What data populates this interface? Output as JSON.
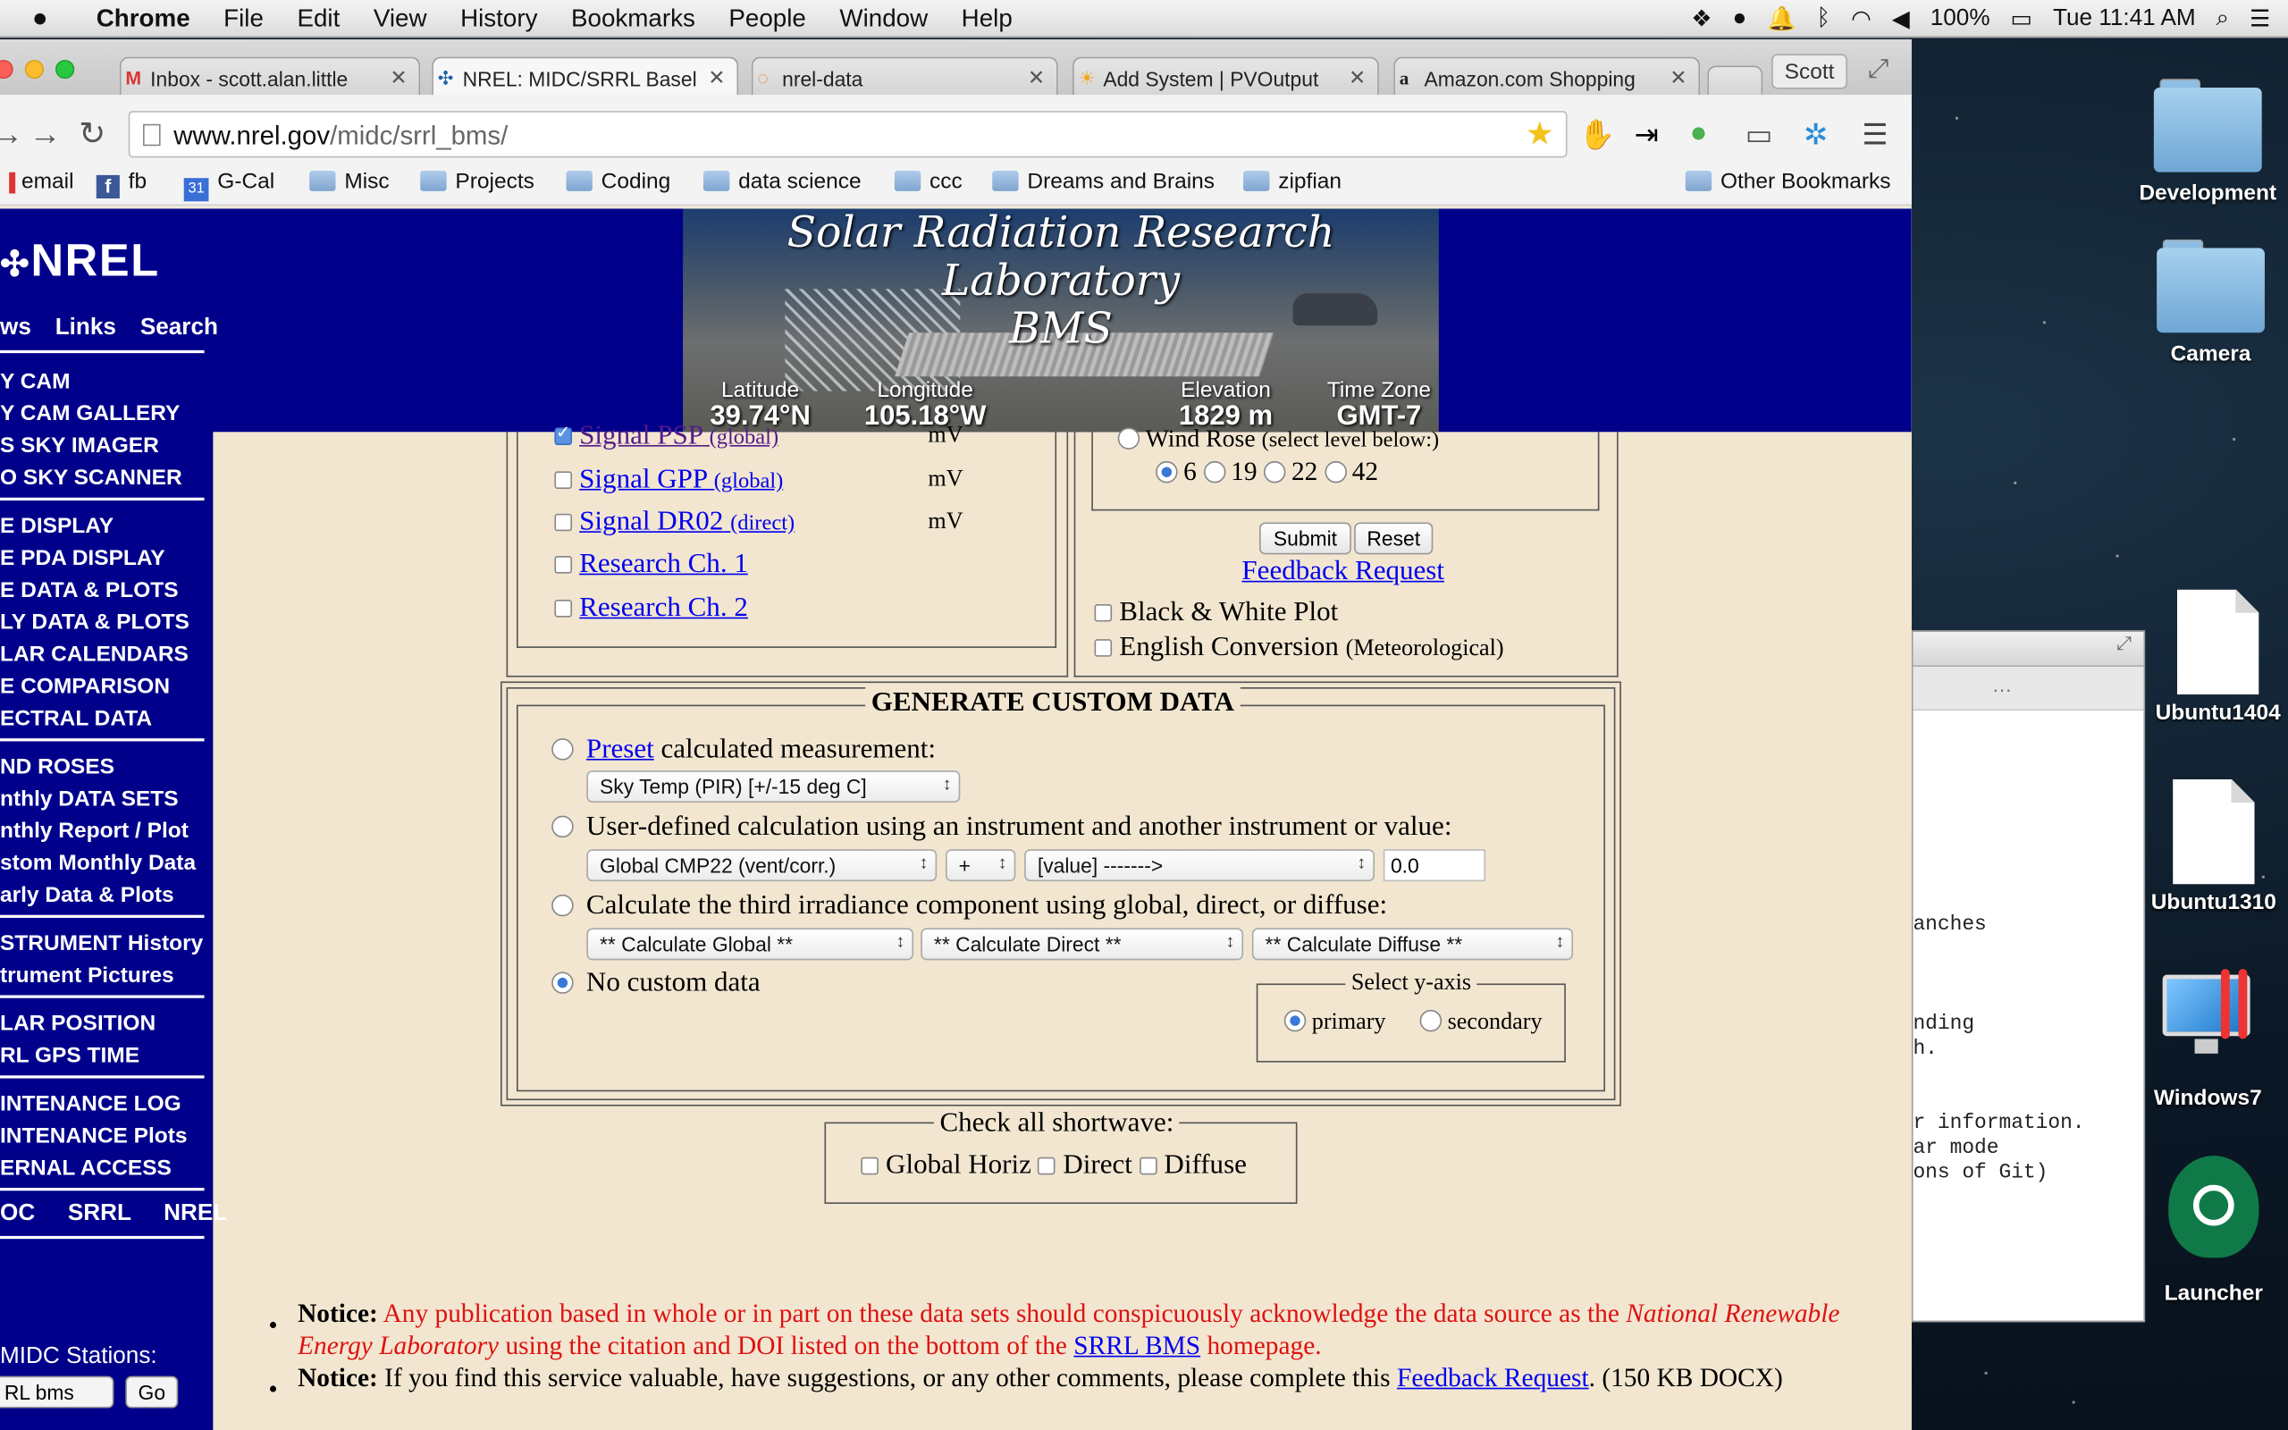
{
  "menubar": {
    "app": "Chrome",
    "items": [
      "File",
      "Edit",
      "View",
      "History",
      "Bookmarks",
      "People",
      "Window",
      "Help"
    ],
    "battery": "100%",
    "clock": "Tue 11:41 AM"
  },
  "desktop": {
    "icons": [
      "Development",
      "Camera",
      "Ubuntu1404",
      "Ubuntu1310",
      "Windows7",
      "Launcher"
    ],
    "terminal_lines": [
      "",
      "",
      "",
      "",
      "",
      "anches",
      "",
      "",
      "",
      "nding",
      "h.",
      "",
      "",
      "r information.",
      "ar mode",
      "ons of Git)"
    ]
  },
  "browser": {
    "tabs": [
      {
        "label": "Inbox - scott.alan.little",
        "icon": "gmail-icon"
      },
      {
        "label": "NREL: MIDC/SRRL Basel",
        "icon": "nrel-icon"
      },
      {
        "label": "nrel-data",
        "icon": "loading-icon"
      },
      {
        "label": "Add System | PVOutput",
        "icon": "sun-icon"
      },
      {
        "label": "Amazon.com Shopping",
        "icon": "amazon-icon"
      }
    ],
    "profile": "Scott",
    "url_host": "www.nrel.gov",
    "url_path": "/midc/srrl_bms/",
    "bookmarks": [
      "email",
      "fb",
      "G-Cal",
      "Misc",
      "Projects",
      "Coding",
      "data science",
      "ccc",
      "Dreams and Brains",
      "zipfian"
    ],
    "other_bookmarks": "Other Bookmarks",
    "gcal_badge": "31"
  },
  "page": {
    "logo": "NREL",
    "banner": {
      "title_line1": "Solar Radiation Research Laboratory",
      "title_line2": "BMS",
      "latitude_label": "Latitude",
      "latitude": "39.74°N",
      "longitude_label": "Longitude",
      "longitude": "105.18°W",
      "elevation_label": "Elevation",
      "elevation": "1829 m",
      "timezone_label": "Time Zone",
      "timezone": "GMT-7"
    },
    "sidebar": {
      "top_links": [
        "ws",
        "Links",
        "Search"
      ],
      "items": [
        "Y CAM",
        "Y CAM GALLERY",
        "S SKY IMAGER",
        "O SKY SCANNER",
        "E DISPLAY",
        "E PDA DISPLAY",
        "E DATA & PLOTS",
        "LY DATA & PLOTS",
        "LAR CALENDARS",
        "E COMPARISON",
        "ECTRAL DATA",
        "ND ROSES",
        "nthly DATA SETS",
        "nthly Report / Plot",
        "stom Monthly Data",
        "arly Data & Plots",
        "STRUMENT History",
        "trument Pictures",
        "LAR POSITION",
        "RL GPS TIME",
        "INTENANCE LOG",
        "INTENANCE Plots",
        "ERNAL ACCESS"
      ],
      "bottom_links": [
        "OC",
        "SRRL",
        "NREL"
      ],
      "stations_label": "MIDC Stations:",
      "station_value": "RL bms",
      "go": "Go"
    },
    "signals": [
      {
        "label": "Signal PSP",
        "qualifier": "(global)",
        "unit": "mV",
        "checked": true
      },
      {
        "label": "Signal GPP",
        "qualifier": "(global)",
        "unit": "mV",
        "checked": false
      },
      {
        "label": "Signal DR02",
        "qualifier": "(direct)",
        "unit": "mV",
        "checked": false
      },
      {
        "label": "Research Ch. 1",
        "qualifier": "",
        "unit": "",
        "checked": false
      },
      {
        "label": "Research Ch. 2",
        "qualifier": "",
        "unit": "",
        "checked": false
      }
    ],
    "wind_rose": {
      "label": "Wind Rose",
      "note": "(select level below:)",
      "levels": [
        "6",
        "19",
        "22",
        "42"
      ],
      "selected": "6"
    },
    "submit": "Submit",
    "reset": "Reset",
    "feedback": "Feedback Request",
    "bw_plot": "Black & White Plot",
    "english_conversion": "English Conversion",
    "english_note": "(Meteorological)",
    "custom": {
      "legend": "GENERATE CUSTOM DATA",
      "preset_link": "Preset",
      "preset_text": "calculated measurement:",
      "preset_select": "Sky Temp (PIR) [+/-15 deg C]",
      "userdef_text": "User-defined calculation using an instrument and another instrument or value:",
      "inst_select": "Global CMP22 (vent/corr.)",
      "op_select": "+",
      "value_select": "[value] ------->",
      "value_input": "0.0",
      "third_text": "Calculate the third irradiance component using global, direct, or diffuse:",
      "calc_global": "** Calculate Global **",
      "calc_direct": "** Calculate Direct **",
      "calc_diffuse": "** Calculate Diffuse **",
      "none_text": "No custom data",
      "yaxis_legend": "Select y-axis",
      "primary": "primary",
      "secondary": "secondary"
    },
    "shortwave": {
      "legend": "Check all shortwave:",
      "items": [
        "Global Horiz",
        "Direct",
        "Diffuse"
      ]
    },
    "notices": {
      "n1_label": "Notice:",
      "n1_a": "Any publication based in whole or in part on these data sets should conspicuously acknowledge the data source as the",
      "n1_italic": "National Renewable Energy Laboratory",
      "n1_b": "using the citation and DOI listed on the bottom of the",
      "n1_link": "SRRL BMS",
      "n1_c": "homepage.",
      "n2_label": "Notice:",
      "n2_a": "If you find this service valuable, have suggestions, or any other comments, please complete this",
      "n2_link": "Feedback Request",
      "n2_b": ". (150 KB DOCX)"
    }
  }
}
